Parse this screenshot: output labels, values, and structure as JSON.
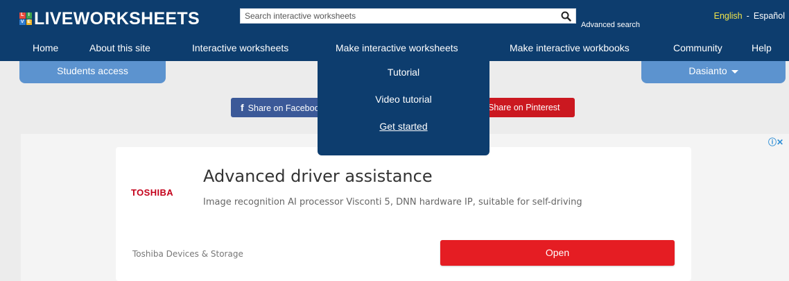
{
  "header": {
    "logo_text": "LIVEWORKSHEETS",
    "logo_tiles": [
      "L",
      "I",
      "V",
      "E"
    ],
    "search_placeholder": "Search interactive worksheets",
    "search_icon": "search-icon",
    "advanced_search": "Advanced search",
    "lang_english": "English",
    "lang_separator": "-",
    "lang_spanish": "Español"
  },
  "nav": {
    "home": "Home",
    "about": "About this site",
    "interactive": "Interactive worksheets",
    "make_worksheets": "Make interactive worksheets",
    "make_workbooks": "Make interactive workbooks",
    "community": "Community",
    "help": "Help"
  },
  "tabs": {
    "students": "Students access",
    "user": "Dasianto"
  },
  "dropdown": {
    "tutorial": "Tutorial",
    "video": "Video tutorial",
    "started": "Get started"
  },
  "share": {
    "facebook_icon": "facebook-icon",
    "facebook": "Share on Facebook",
    "pinterest": "Share on Pinterest"
  },
  "ad": {
    "choices": "ⓘ✕",
    "brand": "TOSHIBA",
    "title": "Advanced driver assistance",
    "desc": "Image recognition AI processor Visconti 5, DNN hardware IP, suitable for self-driving",
    "source": "Toshiba Devices & Storage",
    "button": "Open"
  },
  "colors": {
    "header_bg": "#0d3d6e",
    "tab_bg": "#5c93cf",
    "facebook": "#3b5998",
    "pinterest": "#cb1820",
    "open_button": "#e51d23",
    "lang_highlight": "#f2e64a"
  }
}
